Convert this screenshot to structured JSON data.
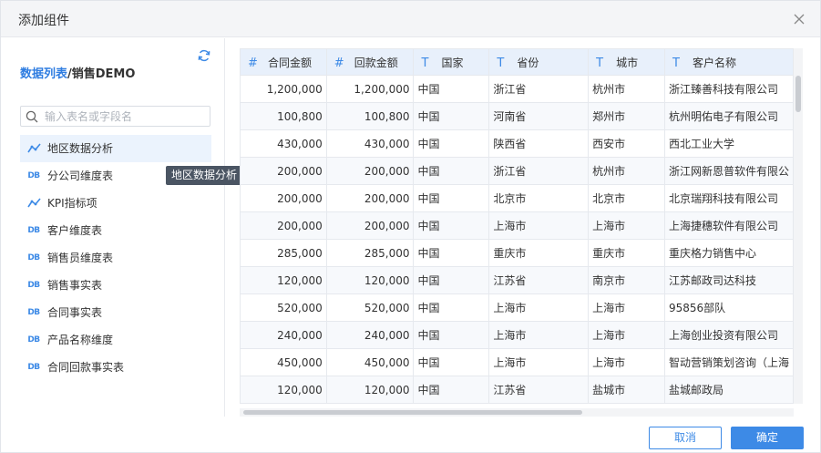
{
  "dialog": {
    "title": "添加组件"
  },
  "sidebar": {
    "breadcrumb_link": "数据列表",
    "breadcrumb_sep": "/",
    "breadcrumb_current": "销售DEMO",
    "search_placeholder": "输入表名或字段名",
    "items": [
      {
        "label": "地区数据分析",
        "icon": "analysis-icon",
        "active": true
      },
      {
        "label": "分公司维度表",
        "icon": "db-icon",
        "active": false
      },
      {
        "label": "KPI指标项",
        "icon": "analysis-icon",
        "active": false
      },
      {
        "label": "客户维度表",
        "icon": "db-icon",
        "active": false
      },
      {
        "label": "销售员维度表",
        "icon": "db-icon",
        "active": false
      },
      {
        "label": "销售事实表",
        "icon": "db-icon",
        "active": false
      },
      {
        "label": "合同事实表",
        "icon": "db-icon",
        "active": false
      },
      {
        "label": "产品名称维度",
        "icon": "db-icon",
        "active": false
      },
      {
        "label": "合同回款事实表",
        "icon": "db-icon",
        "active": false
      }
    ],
    "db_icon_text": "DB"
  },
  "tooltip": "地区数据分析",
  "grid": {
    "columns": [
      {
        "type": "#",
        "label": "合同金额",
        "numeric": true
      },
      {
        "type": "#",
        "label": "回款金额",
        "numeric": true
      },
      {
        "type": "T",
        "label": "国家",
        "numeric": false
      },
      {
        "type": "T",
        "label": "省份",
        "numeric": false
      },
      {
        "type": "T",
        "label": "城市",
        "numeric": false
      },
      {
        "type": "T",
        "label": "客户名称",
        "numeric": false
      }
    ],
    "rows": [
      [
        "1,200,000",
        "1,200,000",
        "中国",
        "浙江省",
        "杭州市",
        "浙江臻善科技有限公司"
      ],
      [
        "100,800",
        "100,800",
        "中国",
        "河南省",
        "郑州市",
        "杭州明佑电子有限公司"
      ],
      [
        "430,000",
        "430,000",
        "中国",
        "陕西省",
        "西安市",
        "西北工业大学"
      ],
      [
        "200,000",
        "200,000",
        "中国",
        "浙江省",
        "杭州市",
        "浙江网新恩普软件有限公"
      ],
      [
        "200,000",
        "200,000",
        "中国",
        "北京市",
        "北京市",
        "北京瑞翔科技有限公司"
      ],
      [
        "200,000",
        "200,000",
        "中国",
        "上海市",
        "上海市",
        "上海捷穗软件有限公司"
      ],
      [
        "285,000",
        "285,000",
        "中国",
        "重庆市",
        "重庆市",
        "重庆格力销售中心"
      ],
      [
        "120,000",
        "120,000",
        "中国",
        "江苏省",
        "南京市",
        "江苏邮政司达科技"
      ],
      [
        "520,000",
        "520,000",
        "中国",
        "上海市",
        "上海市",
        "95856部队"
      ],
      [
        "240,000",
        "240,000",
        "中国",
        "上海市",
        "上海市",
        "上海创业投资有限公司"
      ],
      [
        "450,000",
        "450,000",
        "中国",
        "上海市",
        "上海市",
        "智动营销策划咨询（上海"
      ],
      [
        "120,000",
        "120,000",
        "中国",
        "江苏省",
        "盐城市",
        "盐城邮政局"
      ]
    ]
  },
  "footer": {
    "cancel_label": "取消",
    "ok_label": "确定"
  },
  "colors": {
    "accent": "#3d8ae6",
    "header_bg": "#e8f0fb",
    "active_bg": "#ebf3fd"
  }
}
